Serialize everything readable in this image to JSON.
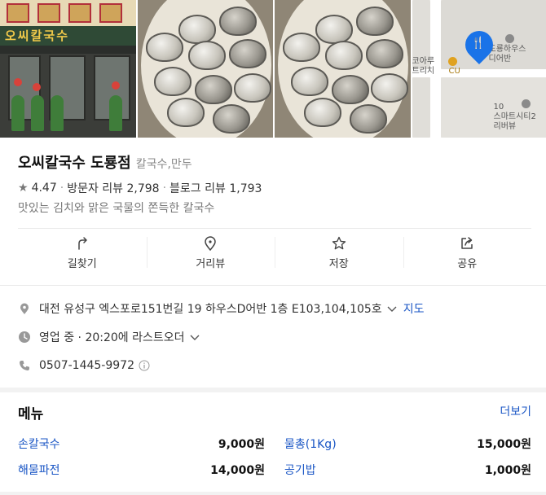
{
  "photos": {
    "storefront_sign": "오씨칼국수",
    "map": {
      "labels": [
        "도룡하우스\n디어반",
        "CU",
        "코아루\n트리치",
        "10\n스마트시티2\n리버뷰"
      ]
    }
  },
  "place": {
    "name": "오씨칼국수 도룡점",
    "category": "칼국수,만두",
    "rating": "4.47",
    "visitor_reviews": "방문자 리뷰 2,798",
    "blog_reviews": "블로그 리뷰 1,793",
    "description": "맛있는 김치와 맑은 국물의 쫀득한 칼국수"
  },
  "actions": [
    {
      "label": "길찾기",
      "icon": "directions-icon"
    },
    {
      "label": "거리뷰",
      "icon": "street-view-icon"
    },
    {
      "label": "저장",
      "icon": "star-icon"
    },
    {
      "label": "공유",
      "icon": "share-icon"
    }
  ],
  "details": {
    "address": "대전 유성구 엑스포로151번길 19 하우스D어반 1층 E103,104,105호",
    "map_link": "지도",
    "hours": "영업 중 · 20:20에 라스트오더",
    "phone": "0507-1445-9972"
  },
  "menu": {
    "title": "메뉴",
    "more": "더보기",
    "items": [
      {
        "name": "손칼국수",
        "price": "9,000원"
      },
      {
        "name": "물총(1Kg)",
        "price": "15,000원"
      },
      {
        "name": "해물파전",
        "price": "14,000원"
      },
      {
        "name": "공기밥",
        "price": "1,000원"
      }
    ]
  },
  "colors": {
    "link": "#1a56c5",
    "pin": "#1a73e8"
  }
}
